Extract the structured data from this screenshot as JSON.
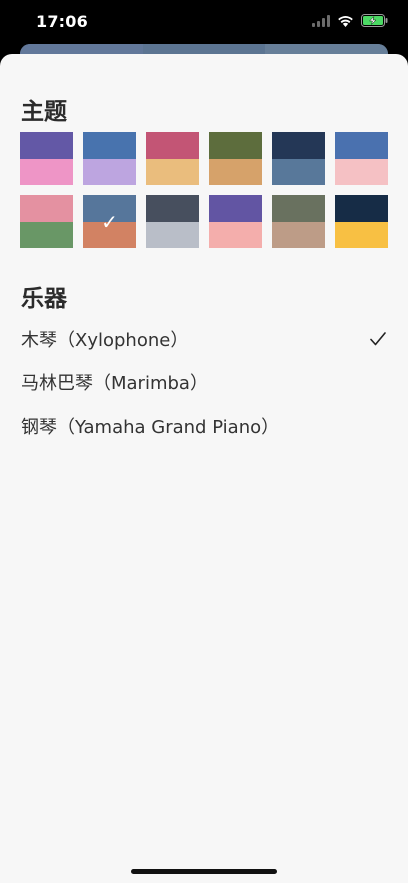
{
  "status_bar": {
    "time": "17:06",
    "battery_color": "#4cd964"
  },
  "behind_card": {
    "colors": [
      "#62789a",
      "#5c7592",
      "#677f99"
    ]
  },
  "theme_section": {
    "title": "主题",
    "selected_index": 7,
    "check_glyph": "✓",
    "themes": [
      {
        "top": "#6358a6",
        "bottom": "#ee95c6"
      },
      {
        "top": "#4873ae",
        "bottom": "#bda5e0"
      },
      {
        "top": "#c35575",
        "bottom": "#eabd7d"
      },
      {
        "top": "#5d6d3d",
        "bottom": "#d6a26a"
      },
      {
        "top": "#243756",
        "bottom": "#58789a"
      },
      {
        "top": "#4a71af",
        "bottom": "#f5c1c4"
      },
      {
        "top": "#e491a1",
        "bottom": "#699766"
      },
      {
        "top": "#56769b",
        "bottom": "#d28263"
      },
      {
        "top": "#474f5e",
        "bottom": "#b9bec8"
      },
      {
        "top": "#6255a3",
        "bottom": "#f4aeac"
      },
      {
        "top": "#69715f",
        "bottom": "#bd9c87"
      },
      {
        "top": "#162c46",
        "bottom": "#f8c043"
      }
    ]
  },
  "instrument_section": {
    "title": "乐器",
    "items": [
      {
        "label": "木琴（Xylophone）",
        "selected": true
      },
      {
        "label": "马林巴琴（Marimba）",
        "selected": false
      },
      {
        "label": "钢琴（Yamaha Grand Piano）",
        "selected": false
      }
    ]
  }
}
